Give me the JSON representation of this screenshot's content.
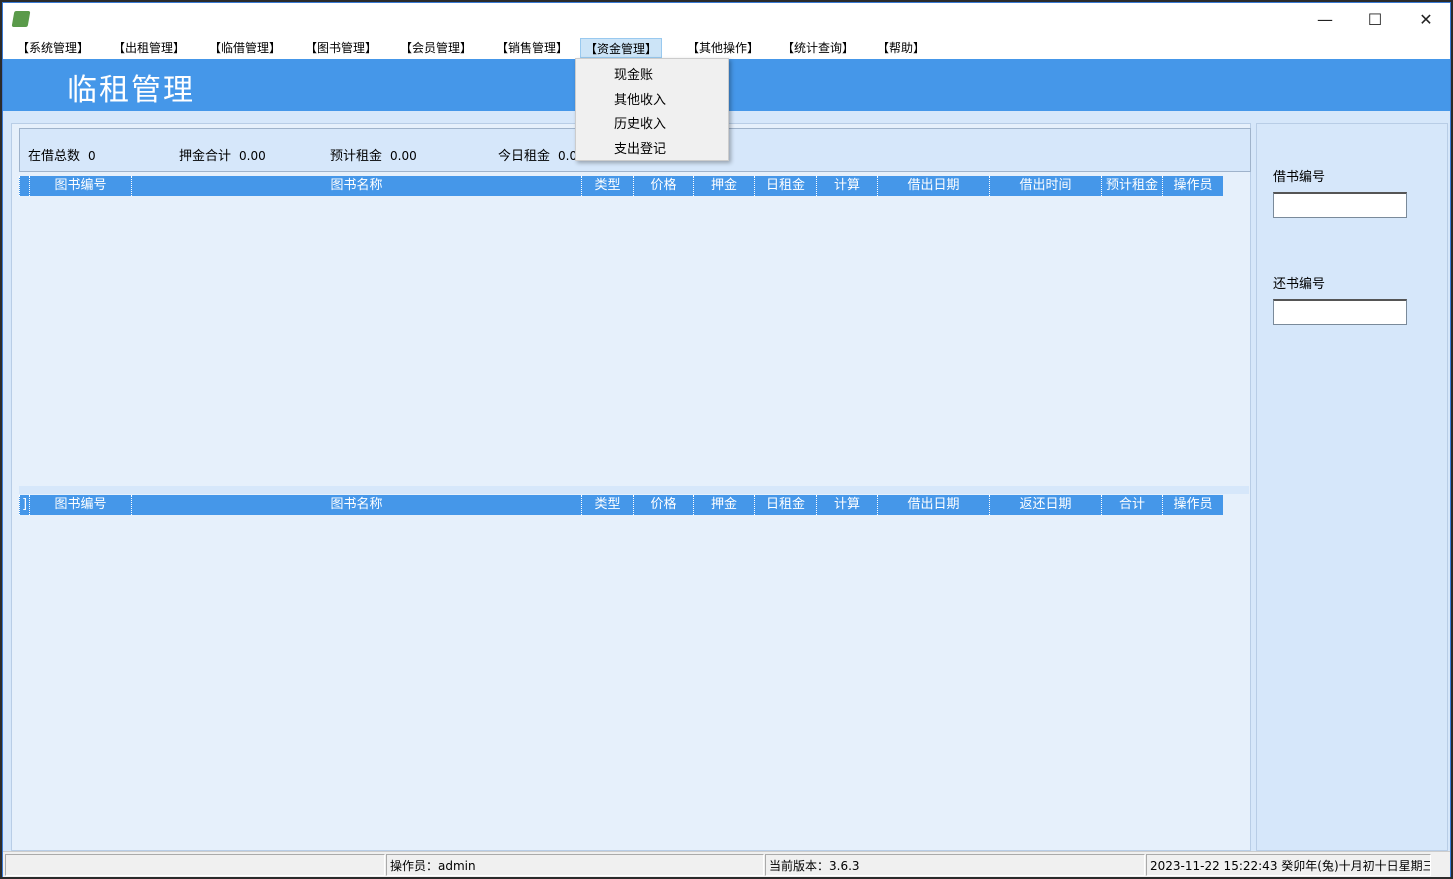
{
  "window": {
    "controls": {
      "minimize": "—",
      "maximize": "☐",
      "close": "✕"
    }
  },
  "menu": [
    "【系统管理】",
    "【出租管理】",
    "【临借管理】",
    "【图书管理】",
    "【会员管理】",
    "【销售管理】",
    "【资金管理】",
    "【其他操作】",
    "【统计查询】",
    "【帮助】"
  ],
  "dropdown": [
    "现金账",
    "其他收入",
    "历史收入",
    "支出登记"
  ],
  "header": {
    "title": "临租管理"
  },
  "summary": [
    {
      "label": "在借总数",
      "value": "0"
    },
    {
      "label": "押金合计",
      "value": "0.00"
    },
    {
      "label": "预计租金",
      "value": "0.00"
    },
    {
      "label": "今日租金",
      "value": "0.0"
    }
  ],
  "grid1": {
    "columns": [
      "",
      "图书编号",
      "图书名称",
      "类型",
      "价格",
      "押金",
      "日租金",
      "计算",
      "借出日期",
      "借出时间",
      "预计租金",
      "操作员"
    ]
  },
  "grid2": {
    "columns": [
      "]",
      "图书编号",
      "图书名称",
      "类型",
      "价格",
      "押金",
      "日租金",
      "计算",
      "借出日期",
      "返还日期",
      "合计",
      "操作员"
    ]
  },
  "right": {
    "borrow_label": "借书编号",
    "return_label": "还书编号",
    "borrow_value": "",
    "return_value": ""
  },
  "status": {
    "blank": "",
    "operator": "操作员：admin",
    "version": "当前版本：3.6.3",
    "datetime": "2023-11-22 15:22:43 癸卯年(兔)十月初十日星期三"
  }
}
